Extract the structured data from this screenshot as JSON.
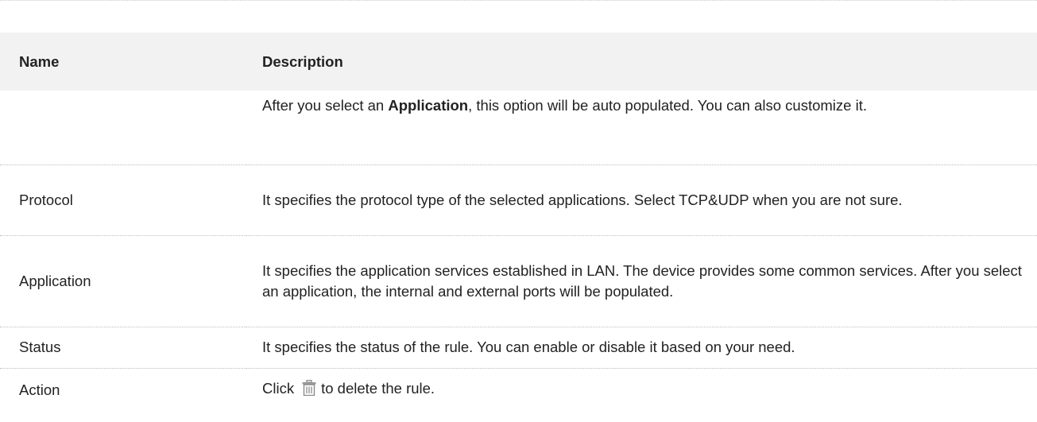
{
  "table": {
    "headers": {
      "name": "Name",
      "description": "Description"
    },
    "continued_row": {
      "desc_prefix": "After you select an ",
      "desc_bold": "Application",
      "desc_suffix": ", this option will be auto populated. You can also customize it."
    },
    "rows": [
      {
        "name": "Protocol",
        "description": "It specifies the protocol type of the selected applications. Select TCP&UDP when you are not sure."
      },
      {
        "name": "Application",
        "description": "It specifies the application services established in LAN. The device provides some common services. After you select an application, the internal and external ports will be populated."
      },
      {
        "name": "Status",
        "description": "It specifies the status of the rule. You can enable or disable it based on your need."
      }
    ],
    "action_row": {
      "name": "Action",
      "desc_before": "Click",
      "icon": "trash-icon",
      "desc_after": "to delete the rule."
    }
  }
}
